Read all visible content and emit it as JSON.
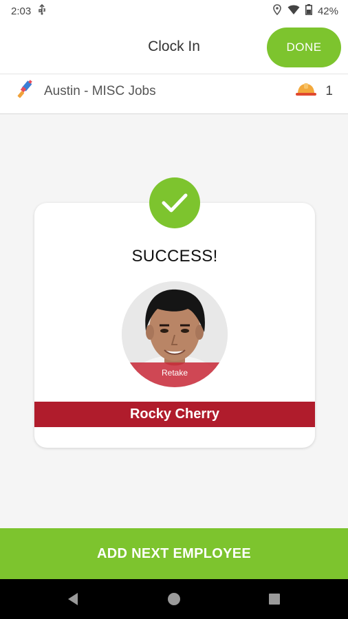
{
  "status_bar": {
    "time": "2:03",
    "battery": "42%",
    "icons": [
      "usb-icon",
      "location-icon",
      "wifi-icon",
      "battery-icon"
    ]
  },
  "header": {
    "title": "Clock In",
    "done_label": "DONE"
  },
  "job_bar": {
    "job_name": "Austin - MISC Jobs",
    "crew_count": "1",
    "icons": [
      "tools-icon",
      "hard-hat-icon"
    ]
  },
  "card": {
    "status_text": "SUCCESS!",
    "retake_label": "Retake",
    "employee_name": "Rocky Cherry"
  },
  "footer": {
    "add_next_label": "ADD NEXT EMPLOYEE"
  },
  "colors": {
    "accent_green": "#7dc42e",
    "name_banner_red": "#b01c2c"
  }
}
